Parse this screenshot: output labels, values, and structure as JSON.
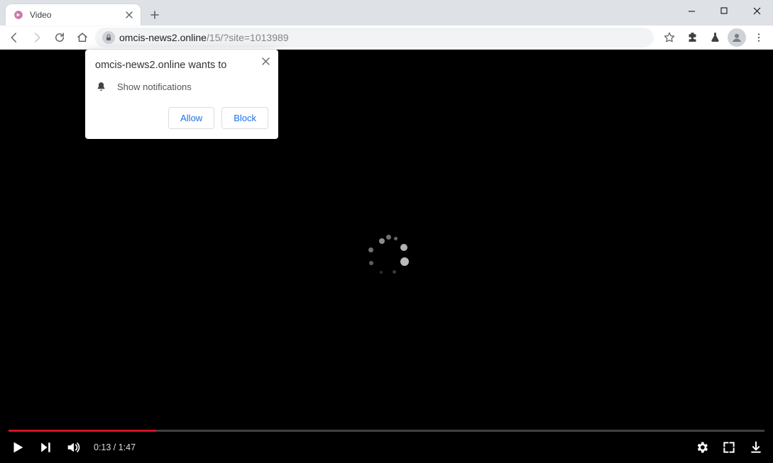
{
  "window": {
    "tab_title": "Video"
  },
  "toolbar": {
    "url_host": "omcis-news2.online",
    "url_path": "/15/?site=1013989"
  },
  "permission_popup": {
    "title": "omcis-news2.online wants to",
    "message": "Show notifications",
    "allow_label": "Allow",
    "block_label": "Block"
  },
  "player": {
    "current_time": "0:13",
    "duration": "1:47",
    "time_display": "0:13 / 1:47",
    "progress_percent": 19.5
  }
}
